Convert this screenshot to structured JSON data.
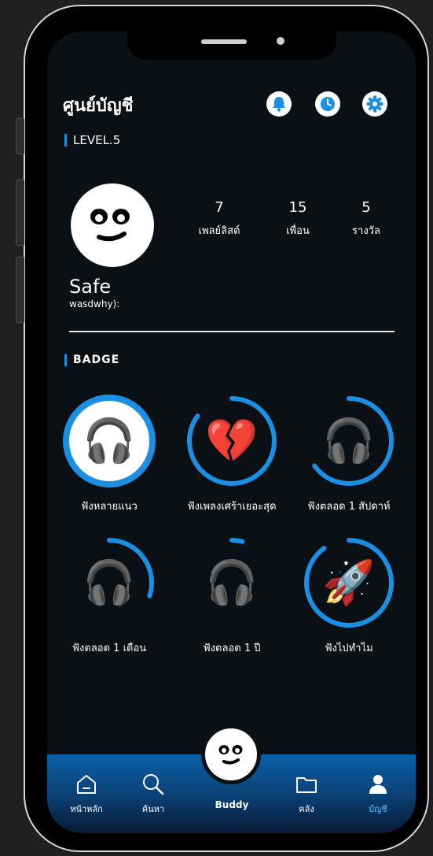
{
  "header": {
    "title": "ศูนย์บัญชี",
    "icons": [
      "bell-icon",
      "history-icon",
      "gear-icon"
    ]
  },
  "profile": {
    "level": "LEVEL.5",
    "name": "Safe",
    "handle": "wasdwhy):",
    "stats": [
      {
        "value": "7",
        "label": "เพลย์ลิสต์"
      },
      {
        "value": "15",
        "label": "เพื่อน"
      },
      {
        "value": "5",
        "label": "รางวัล"
      }
    ]
  },
  "badges": {
    "title": "BADGE",
    "items": [
      {
        "label": "ฟังหลายแนว",
        "icon": "headphones-icon",
        "progress": 1.0
      },
      {
        "label": "ฟังเพลงเศร้าเยอะสุด",
        "icon": "broken-heart-icon",
        "progress": 0.85
      },
      {
        "label": "ฟังตลอด 1 สัปดาห์",
        "icon": "headphones-icon",
        "progress": 0.65
      },
      {
        "label": "ฟังตลอด 1 เดือน",
        "icon": "headphones-icon",
        "progress": 0.3
      },
      {
        "label": "ฟังตลอด 1 ปี",
        "icon": "headphones-icon",
        "progress": 0.04
      },
      {
        "label": "ฟังไปทำไม",
        "icon": "rocket-icon",
        "progress": 0.9
      }
    ]
  },
  "tabbar": {
    "home": "หน้าหลัก",
    "search": "ค้นหา",
    "buddy": "Buddy",
    "library": "คลัง",
    "account": "บัญชี",
    "active": "account"
  },
  "colors": {
    "accent": "#1a8fe3",
    "active_tab": "#5cc0ff",
    "background": "#0b1015"
  }
}
